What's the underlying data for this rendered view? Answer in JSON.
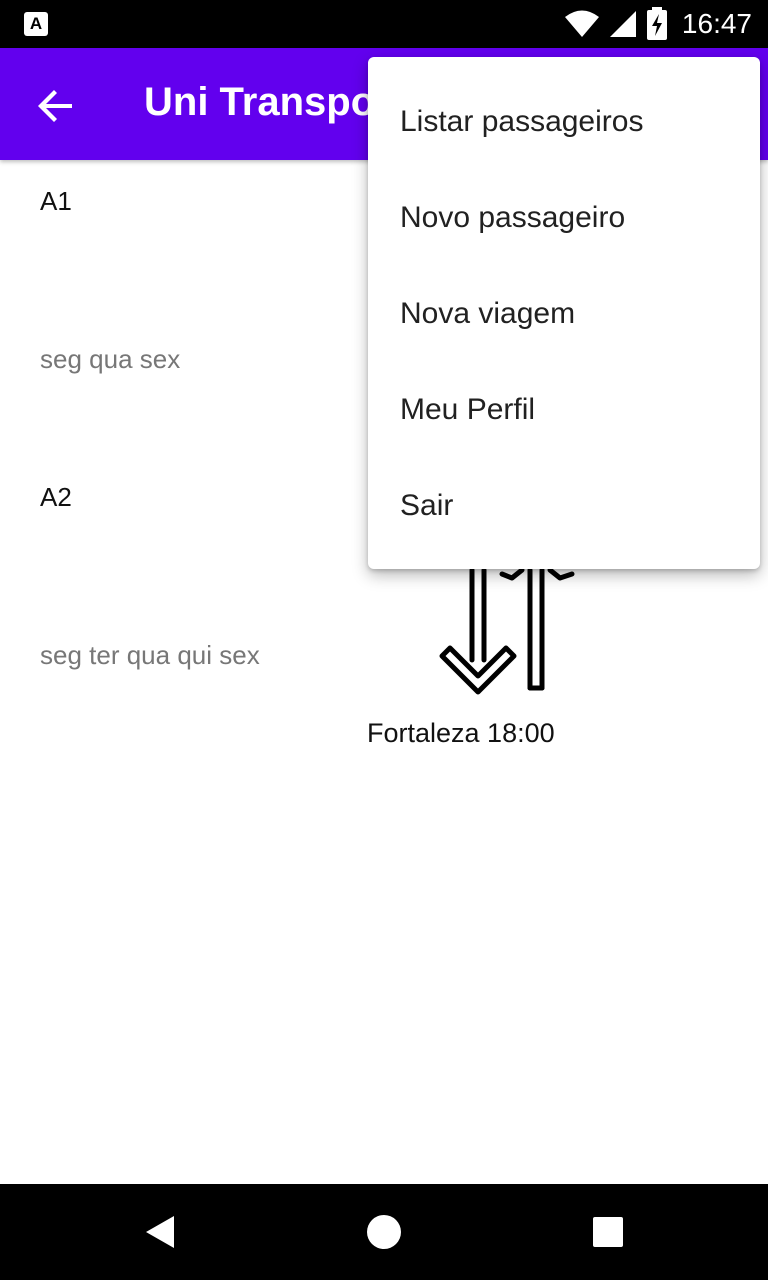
{
  "status_bar": {
    "app_icon_letter": "A",
    "time": "16:47",
    "icons": [
      "wifi-icon",
      "signal-icon",
      "battery-charging-icon"
    ]
  },
  "app_bar": {
    "title": "Uni Transpo",
    "back_icon": "arrow-left-icon",
    "background_color": "#6200ee"
  },
  "routes": [
    {
      "name": "A1",
      "days": "seg qua sex"
    },
    {
      "name": "A2",
      "days": "seg ter qua qui sex"
    }
  ],
  "trip": {
    "icon": "swap-vertical-arrows-icon",
    "destination": "Fortaleza 18:00"
  },
  "overflow_menu": {
    "items": [
      {
        "label": "Listar passageiros"
      },
      {
        "label": "Novo passageiro"
      },
      {
        "label": "Nova viagem"
      },
      {
        "label": "Meu Perfil"
      },
      {
        "label": "Sair"
      }
    ]
  },
  "nav_bar": {
    "icons": [
      "back-triangle-icon",
      "home-circle-icon",
      "recents-square-icon"
    ]
  }
}
